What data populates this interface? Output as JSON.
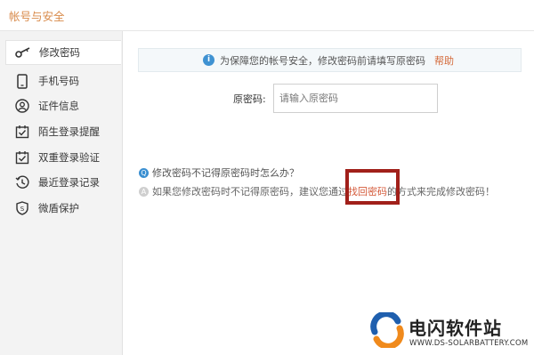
{
  "window": {
    "title": "帐号与安全"
  },
  "sidebar": {
    "items": [
      {
        "label": "修改密码",
        "icon": "key-icon"
      },
      {
        "label": "手机号码",
        "icon": "phone-icon"
      },
      {
        "label": "证件信息",
        "icon": "id-card-icon"
      },
      {
        "label": "陌生登录提醒",
        "icon": "calendar-check-icon"
      },
      {
        "label": "双重登录验证",
        "icon": "calendar-check-icon"
      },
      {
        "label": "最近登录记录",
        "icon": "history-icon"
      },
      {
        "label": "微盾保护",
        "icon": "shield-icon"
      }
    ]
  },
  "notice": {
    "text": "为保障您的帐号安全，修改密码前请填写原密码",
    "help_label": "帮助"
  },
  "form": {
    "old_password_label": "原密码:",
    "old_password_placeholder": "请输入原密码",
    "old_password_value": ""
  },
  "faq": {
    "question": "修改密码不记得原密码时怎么办？",
    "answer_prefix": "如果您修改密码时不记得原密码，建议您通过",
    "answer_link": "找回密码",
    "answer_suffix": "的方式来完成修改密码！"
  },
  "watermark": {
    "name": "电闪软件站",
    "url": "WWW.DS-SOLARBATTERY.COM"
  },
  "colors": {
    "accent": "#d88a4a",
    "link": "#d45a3a",
    "highlight_border": "#a1201a",
    "info_blue": "#3f92d2"
  }
}
